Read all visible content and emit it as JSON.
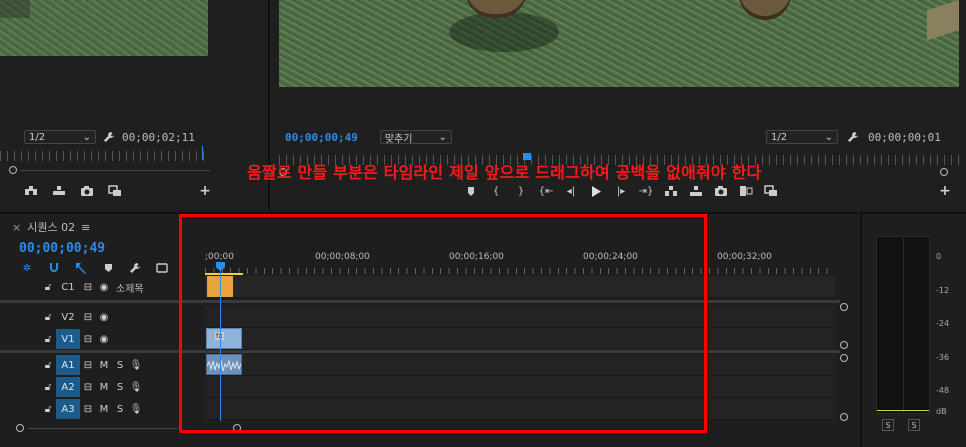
{
  "source_monitor": {
    "resolution": "1/2",
    "timecode": "00;00;02;11"
  },
  "program_monitor": {
    "playhead_timecode": "00;00;00;49",
    "fit": "맞추기",
    "resolution": "1/2",
    "duration_timecode": "00;00;00;01"
  },
  "annotation": "움짤로 만들 부분은 타임라인 제일 앞으로 드래그하여 공백을 없애줘야 한다",
  "timeline": {
    "close_glyph": "×",
    "sequence_name": "시퀀스 02",
    "menu_glyph": "≡",
    "current_time": "00;00;00;49",
    "ruler_labels": [
      ";00;00",
      "00;00;08;00",
      "00;00;16;00",
      "00;00;24;00",
      "00;00;32;00"
    ],
    "tracks": [
      {
        "name": "C1",
        "label": "소제목",
        "type": "caption"
      },
      {
        "name": "V2",
        "type": "video"
      },
      {
        "name": "V1",
        "type": "video",
        "targeted": true
      },
      {
        "name": "A1",
        "type": "audio",
        "targeted": true
      },
      {
        "name": "A2",
        "type": "audio",
        "targeted": true
      },
      {
        "name": "A3",
        "type": "audio",
        "targeted": true
      }
    ],
    "mute_label": "M",
    "solo_label": "S",
    "clip_fx": "fx",
    "colors": {
      "caption_clip": "#e8a23e",
      "video_clip": "#8fb3d9",
      "audio_clip": "#6d8fb8",
      "playhead": "#2d8ceb",
      "annotation": "#ff1a1a"
    }
  },
  "meters": {
    "scale": [
      "0",
      "-12",
      "-24",
      "-36",
      "-48",
      "dB"
    ],
    "solo_buttons": [
      "S",
      "S"
    ]
  }
}
